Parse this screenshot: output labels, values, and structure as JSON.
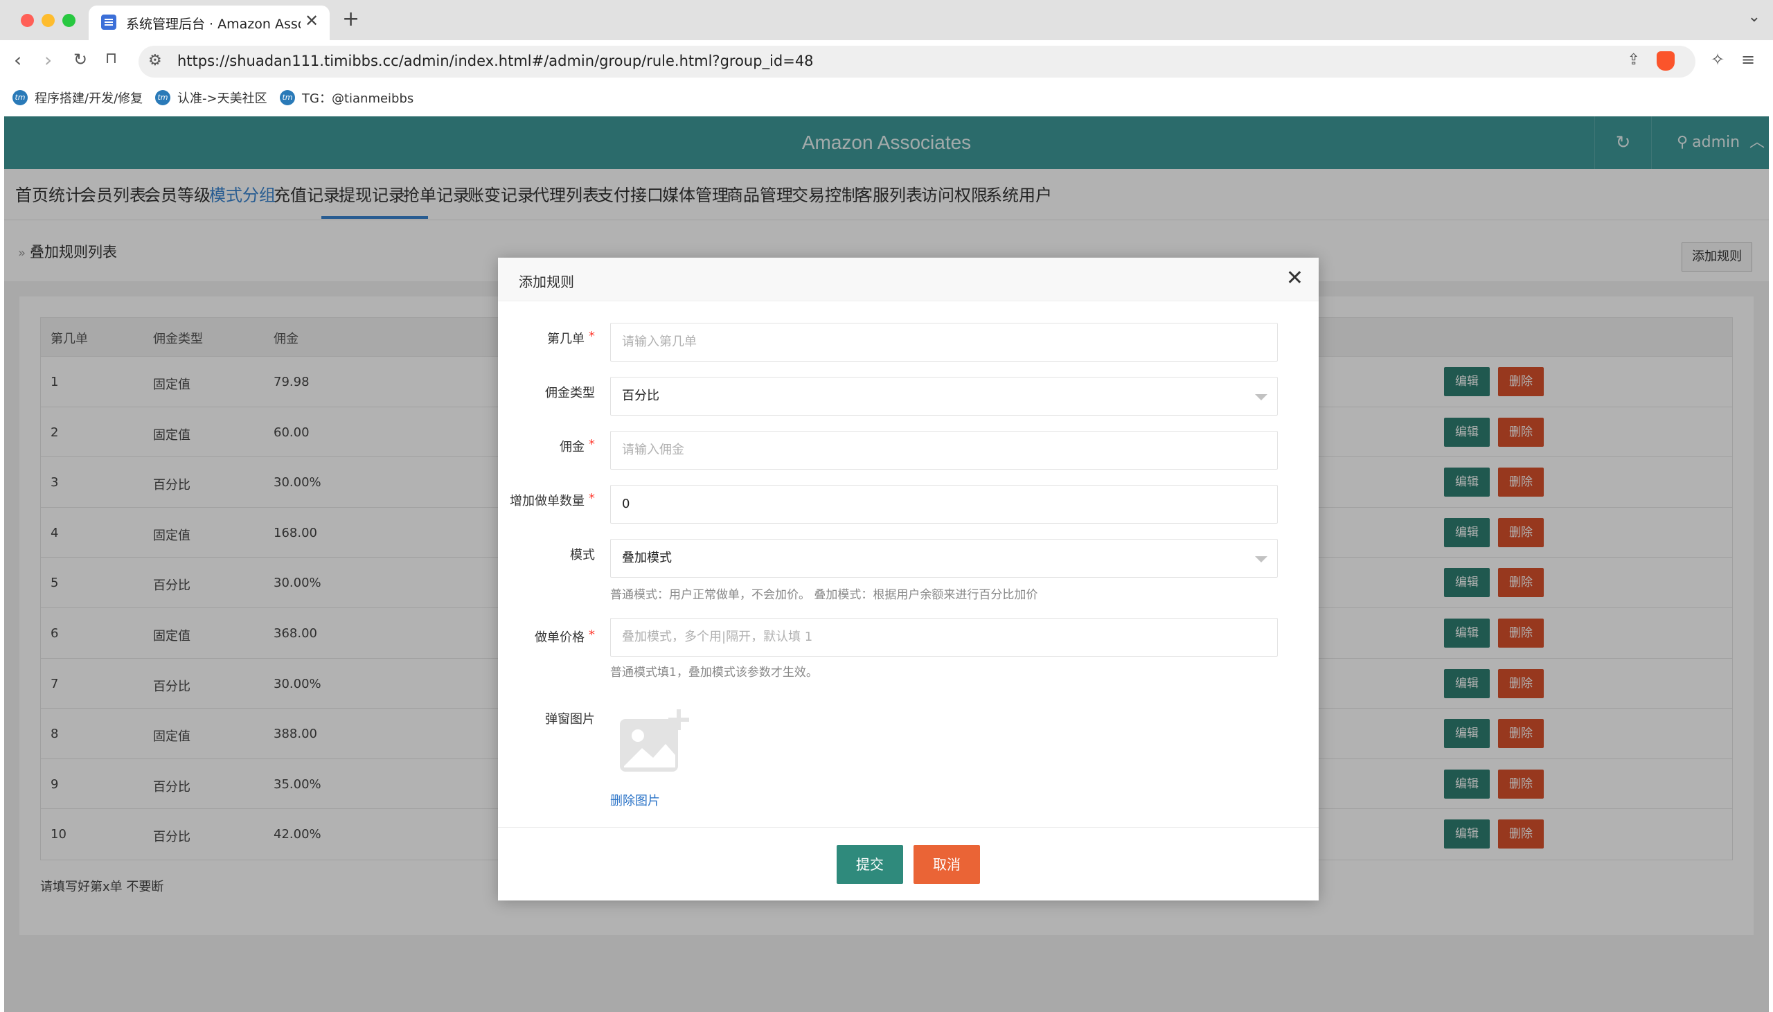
{
  "browser": {
    "tab_title": "系统管理后台 · Amazon Associates",
    "url": "https://shuadan111.timibbs.cc/admin/index.html#/admin/group/rule.html?group_id=48",
    "bookmarks": [
      {
        "label": "程序搭建/开发/修复"
      },
      {
        "label": "认准->天美社区"
      },
      {
        "label": "TG：@tianmeibbs"
      }
    ]
  },
  "app": {
    "title": "Amazon Associates",
    "user": "admin",
    "menu": [
      "首页统计",
      "会员列表",
      "会员等级",
      "模式分组",
      "充值记录",
      "提现记录",
      "抢单记录",
      "账变记录",
      "代理列表",
      "支付接口",
      "媒体管理",
      "商品管理",
      "交易控制",
      "客服列表",
      "访问权限",
      "系统用户"
    ],
    "active_menu": "模式分组",
    "breadcrumb": "叠加规则列表",
    "add_rule_label": "添加规则"
  },
  "table": {
    "columns": [
      "第几单",
      "佣金类型",
      "佣金"
    ],
    "rows": [
      {
        "n": "1",
        "type": "固定值",
        "amount": "79.98"
      },
      {
        "n": "2",
        "type": "固定值",
        "amount": "60.00"
      },
      {
        "n": "3",
        "type": "百分比",
        "amount": "30.00%"
      },
      {
        "n": "4",
        "type": "固定值",
        "amount": "168.00"
      },
      {
        "n": "5",
        "type": "百分比",
        "amount": "30.00%"
      },
      {
        "n": "6",
        "type": "固定值",
        "amount": "368.00"
      },
      {
        "n": "7",
        "type": "百分比",
        "amount": "30.00%"
      },
      {
        "n": "8",
        "type": "固定值",
        "amount": "388.00"
      },
      {
        "n": "9",
        "type": "百分比",
        "amount": "35.00%"
      },
      {
        "n": "10",
        "type": "百分比",
        "amount": "42.00%"
      }
    ],
    "edit_label": "编辑",
    "delete_label": "删除",
    "tip": "请填写好第x单 不要断"
  },
  "modal": {
    "title": "添加规则",
    "fields": {
      "order_no": {
        "label": "第几单",
        "placeholder": "请输入第几单",
        "value": ""
      },
      "commission_type": {
        "label": "佣金类型",
        "value": "百分比"
      },
      "commission": {
        "label": "佣金",
        "placeholder": "请输入佣金",
        "value": ""
      },
      "extra_count": {
        "label": "增加做单数量",
        "value": "0"
      },
      "mode": {
        "label": "模式",
        "value": "叠加模式",
        "help": "普通模式：用户正常做单，不会加价。 叠加模式：根据用户余额来进行百分比加价"
      },
      "price": {
        "label": "做单价格",
        "placeholder": "叠加模式，多个用|隔开，默认填 1",
        "help": "普通模式填1，叠加模式该参数才生效。"
      },
      "popup_image": {
        "label": "弹窗图片",
        "delete_label": "删除图片"
      }
    },
    "submit_label": "提交",
    "cancel_label": "取消"
  },
  "colors": {
    "header": "#3e9a9a",
    "active_menu": "#3a85d0",
    "edit_button": "#2f7f71",
    "delete_button": "#d9512b",
    "submit_button": "#2f8a7c",
    "cancel_button": "#ea6436"
  }
}
